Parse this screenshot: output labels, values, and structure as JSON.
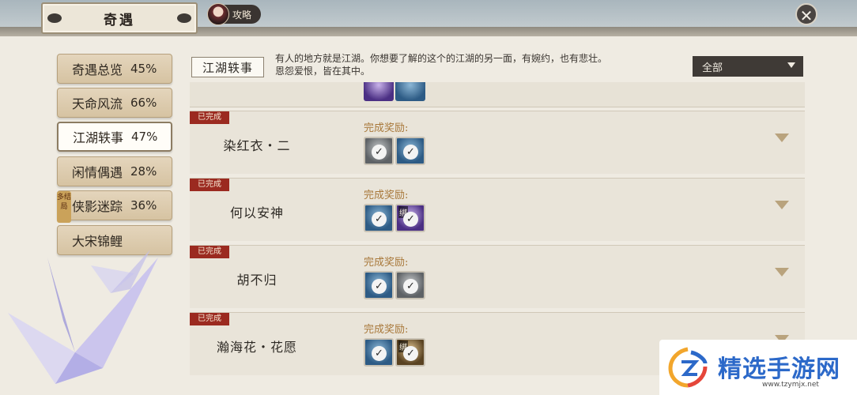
{
  "header": {
    "title": "奇遇",
    "guide_label": "攻略",
    "close_symbol": "✕"
  },
  "sidebar": {
    "items": [
      {
        "label": "奇遇总览",
        "percent": "45%"
      },
      {
        "label": "天命风流",
        "percent": "66%"
      },
      {
        "label": "江湖轶事",
        "percent": "47%"
      },
      {
        "label": "闲情偶遇",
        "percent": "28%"
      },
      {
        "label": "侠影迷踪",
        "percent": "36%"
      },
      {
        "label": "大宋锦鲤",
        "percent": ""
      }
    ],
    "active_index": 2,
    "tag_label": "多结局"
  },
  "category": {
    "title": "江湖轶事",
    "description": "有人的地方就是江湖。你想要了解的这个的江湖的另一面，有婉约，也有悲壮。恩怨爱恨，皆在其中。",
    "filter_value": "全部"
  },
  "list": {
    "reward_label": "完成奖励:",
    "done_label": "已完成",
    "check_symbol": "✓",
    "bound_label": "绑",
    "rows": [
      {
        "name": "染红衣・二",
        "rewards": [
          {
            "icon": "gray-item-icon"
          },
          {
            "icon": "blue-item-icon"
          }
        ]
      },
      {
        "name": "何以安神",
        "rewards": [
          {
            "icon": "blue-item-icon"
          },
          {
            "icon": "purple-item-icon",
            "bound": true
          }
        ]
      },
      {
        "name": "胡不归",
        "rewards": [
          {
            "icon": "blue-item-icon"
          },
          {
            "icon": "gray-item-icon"
          }
        ]
      },
      {
        "name": "瀚海花・花愿",
        "rewards": [
          {
            "icon": "blue-item-icon"
          },
          {
            "icon": "gold-item-icon",
            "bound": true
          }
        ]
      }
    ]
  },
  "watermark": {
    "text": "精选手游网",
    "url": "www.tzymjx.net"
  },
  "colors": {
    "done_tag": "#9b2a20",
    "reward_label": "#a8783a",
    "watermark_text": "#2c69c9"
  }
}
